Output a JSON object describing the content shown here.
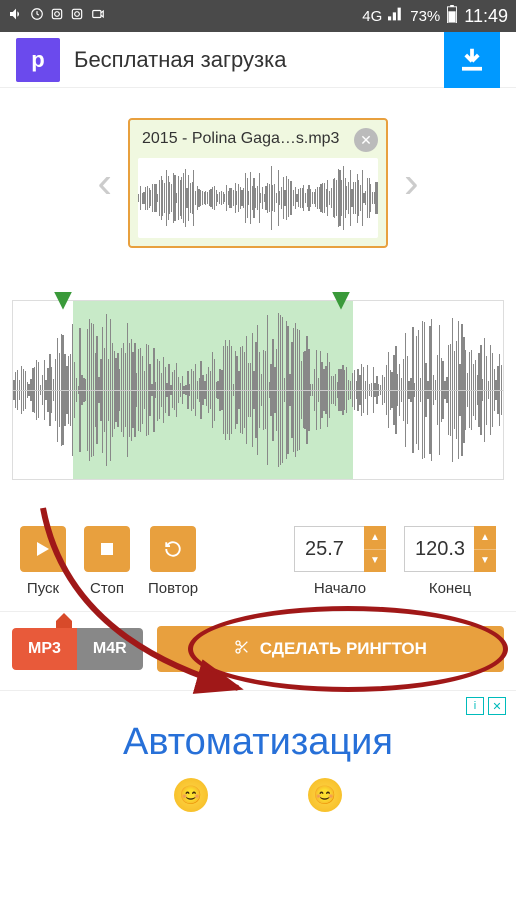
{
  "status": {
    "network": "4G",
    "battery": "73%",
    "time": "11:49"
  },
  "banner": {
    "icon_letter": "p",
    "text": "Бесплатная загрузка"
  },
  "file_card": {
    "filename": "2015 - Polina Gaga…s.mp3"
  },
  "controls": {
    "play": "Пуск",
    "stop": "Стоп",
    "repeat": "Повтор",
    "start_label": "Начало",
    "end_label": "Конец",
    "start_value": "25.7",
    "end_value": "120.3"
  },
  "formats": {
    "mp3": "MP3",
    "m4r": "M4R"
  },
  "make_button": "СДЕЛАТЬ РИНГТОН",
  "ad": {
    "headline": "Автоматизация"
  }
}
